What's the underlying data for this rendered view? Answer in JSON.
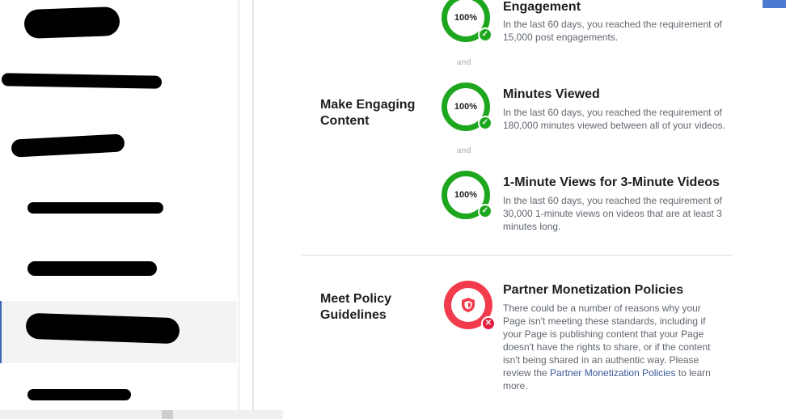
{
  "colors": {
    "success": "#1ea71e",
    "error": "#f23b4c",
    "link": "#385898",
    "accent": "#4267b2"
  },
  "sidebar": {
    "items": [
      {
        "label": "",
        "redacted": true
      },
      {
        "label": "",
        "redacted": true
      },
      {
        "label": "",
        "redacted": true
      },
      {
        "label": "",
        "redacted": true
      },
      {
        "label": "",
        "redacted": true
      },
      {
        "label": "",
        "redacted": true,
        "active": true
      },
      {
        "label": "",
        "redacted": true
      }
    ]
  },
  "sections": {
    "engaging": {
      "label": "Make Engaging Content",
      "and_separator": "and",
      "requirements": [
        {
          "percent": "100%",
          "status_icon": "check-icon",
          "title": "Engagement",
          "description": "In the last 60 days, you reached the requirement of 15,000 post engagements."
        },
        {
          "percent": "100%",
          "status_icon": "check-icon",
          "title": "Minutes Viewed",
          "description": "In the last 60 days, you reached the requirement of 180,000 minutes viewed between all of your videos."
        },
        {
          "percent": "100%",
          "status_icon": "check-icon",
          "title": "1-Minute Views for 3-Minute Videos",
          "description": "In the last 60 days, you reached the requirement of 30,000 1-minute views on videos that are at least 3 minutes long."
        }
      ]
    },
    "policy": {
      "label": "Meet Policy Guidelines",
      "icon": "shield-icon",
      "status_icon": "x-icon",
      "title": "Partner Monetization Policies",
      "description_before": "There could be a number of reasons why your Page isn't meeting these standards, including if your Page is publishing content that your Page doesn't have the rights to share, or if the content isn't being shared in an authentic way. Please review the ",
      "link_text": "Partner Monetization Policies",
      "description_after": " to learn more."
    }
  }
}
